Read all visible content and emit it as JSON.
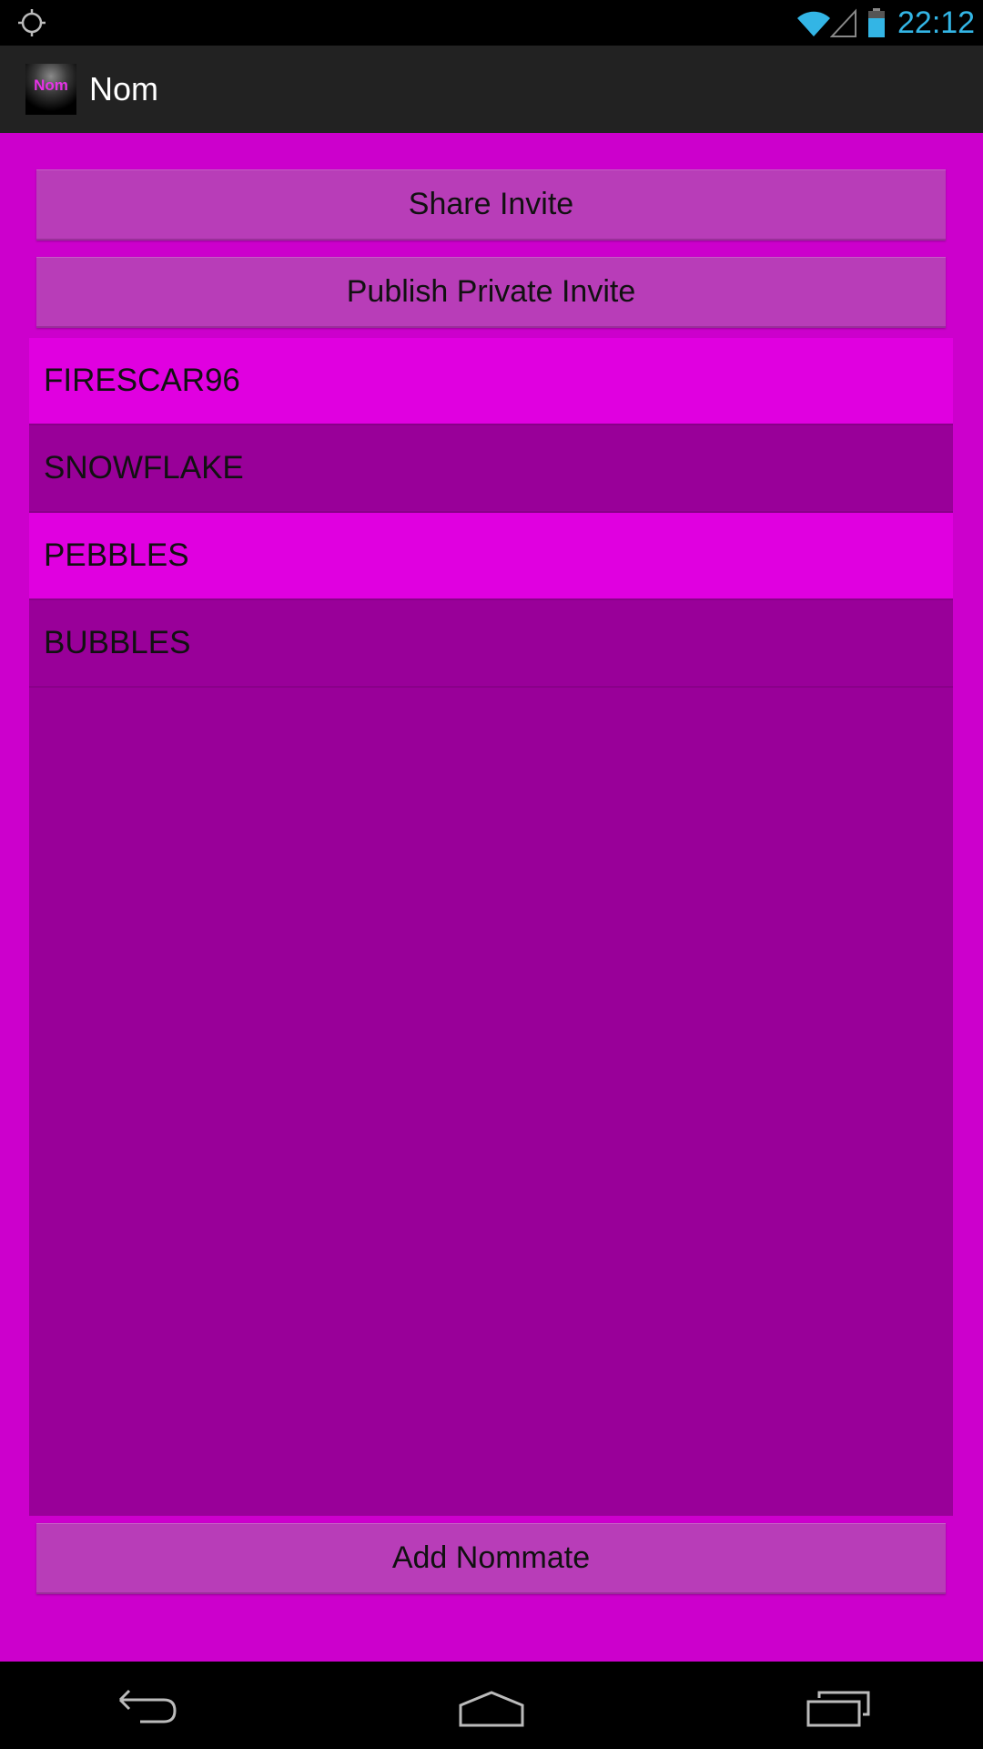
{
  "status_bar": {
    "time": "22:12",
    "icons": [
      "gps-icon",
      "wifi-icon",
      "signal-icon",
      "battery-icon"
    ],
    "clock_color": "#33b5e5"
  },
  "action_bar": {
    "app_icon_text": "Nom",
    "title": "Nom"
  },
  "buttons": {
    "share_invite": "Share Invite",
    "publish_private_invite": "Publish Private Invite",
    "add_nommate": "Add Nommate"
  },
  "nommates": [
    {
      "name": "FIRESCAR96"
    },
    {
      "name": "SNOWFLAKE"
    },
    {
      "name": "PEBBLES"
    },
    {
      "name": "BUBBLES"
    }
  ],
  "colors": {
    "background": "#cc00cc",
    "button": "#b83db8",
    "list_light": "#e000e0",
    "list_dark": "#990099",
    "action_bar": "#222222"
  },
  "nav_bar": {
    "icons": [
      "back-icon",
      "home-icon",
      "recent-apps-icon"
    ]
  }
}
